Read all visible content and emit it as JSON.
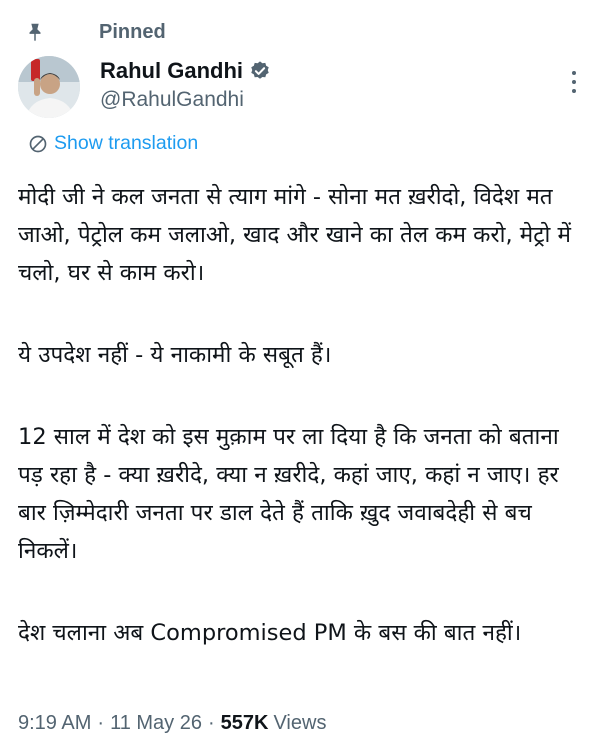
{
  "pinned": {
    "label": "Pinned",
    "icon": "pin-icon"
  },
  "author": {
    "name": "Rahul Gandhi",
    "handle": "@RahulGandhi",
    "verified_icon": "verified-badge-icon",
    "verified_color": "#536471"
  },
  "translation": {
    "label": "Show translation",
    "icon": "globe-translate-icon",
    "color": "#1d9bf0"
  },
  "tweet": {
    "paragraphs": [
      "मोदी जी ने कल जनता से त्याग मांगे - सोना मत ख़रीदो, विदेश मत जाओ, पेट्रोल कम जलाओ, खाद और खाने का तेल कम करो, मेट्रो में चलो, घर से काम करो।",
      "ये उपदेश नहीं - ये नाकामी के सबूत हैं।",
      "12 साल में देश को इस मुक़ाम पर ला दिया है कि जनता को बताना पड़ रहा है - क्या ख़रीदे, क्या न ख़रीदे, कहां जाए, कहां न जाए। हर बार ज़िम्मेदारी जनता पर डाल देते हैं ताकि ख़ुद जवाबदेही से बच निकलें।",
      "देश चलाना अब Compromised PM के बस की बात नहीं।"
    ]
  },
  "meta": {
    "time": "9:19 AM",
    "separator": "·",
    "date": "11 May 26",
    "views_count": "557K",
    "views_label": "Views"
  },
  "colors": {
    "text": "#0f1419",
    "secondary": "#536471",
    "link": "#1d9bf0"
  }
}
